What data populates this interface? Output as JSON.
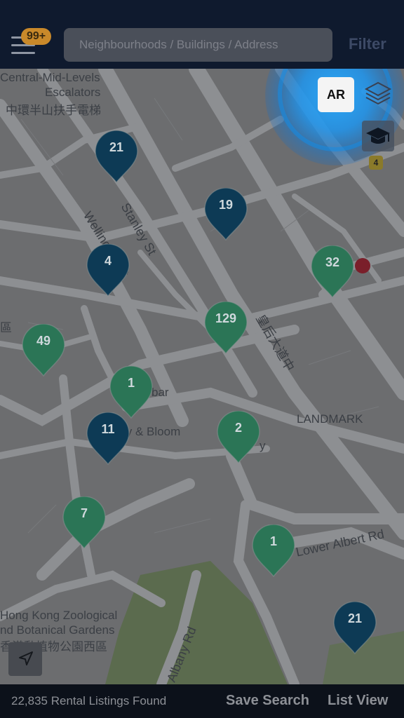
{
  "header": {
    "notification_count": "99+",
    "search_placeholder": "Neighbourhoods / Buildings / Address",
    "filter_label": "Filter"
  },
  "map": {
    "ar_label": "AR",
    "labels": {
      "escalators_line1": "Central-Mid-Levels",
      "escalators_line2": "Escalators",
      "escalators_chinese": "中環半山扶手電梯",
      "stanley": "Stanley St",
      "wellington": "Wellington St",
      "queens_road": "皇后大道中",
      "landmark": "LANDMARK",
      "lower_albert": "Lower Albert Rd",
      "zoo_line1": "Hong Kong Zoological",
      "zoo_line2": "nd Botanical Gardens",
      "zoo_chinese": "香港動植物公園西區",
      "albany": "Albany Rd",
      "lily_bloom": "ly & Bloom",
      "partial_district": "區",
      "partial_bar": "bar",
      "partial_ny": "y",
      "metro_exit": "4"
    },
    "pins": [
      {
        "count": "21",
        "kind": "building"
      },
      {
        "count": "19",
        "kind": "building"
      },
      {
        "count": "4",
        "kind": "building"
      },
      {
        "count": "32",
        "kind": "area"
      },
      {
        "count": "129",
        "kind": "area"
      },
      {
        "count": "49",
        "kind": "area"
      },
      {
        "count": "1",
        "kind": "area"
      },
      {
        "count": "11",
        "kind": "building"
      },
      {
        "count": "2",
        "kind": "area"
      },
      {
        "count": "7",
        "kind": "area"
      },
      {
        "count": "1",
        "kind": "area"
      },
      {
        "count": "21",
        "kind": "building"
      }
    ],
    "colors": {
      "building": "#0d3a55",
      "area": "#2b7556",
      "land": "#6c6d6f",
      "road": "#8c8e91",
      "park": "#5b6b4e"
    }
  },
  "footer": {
    "results_text": "22,835 Rental Listings Found",
    "save_search": "Save Search",
    "list_view": "List View"
  }
}
